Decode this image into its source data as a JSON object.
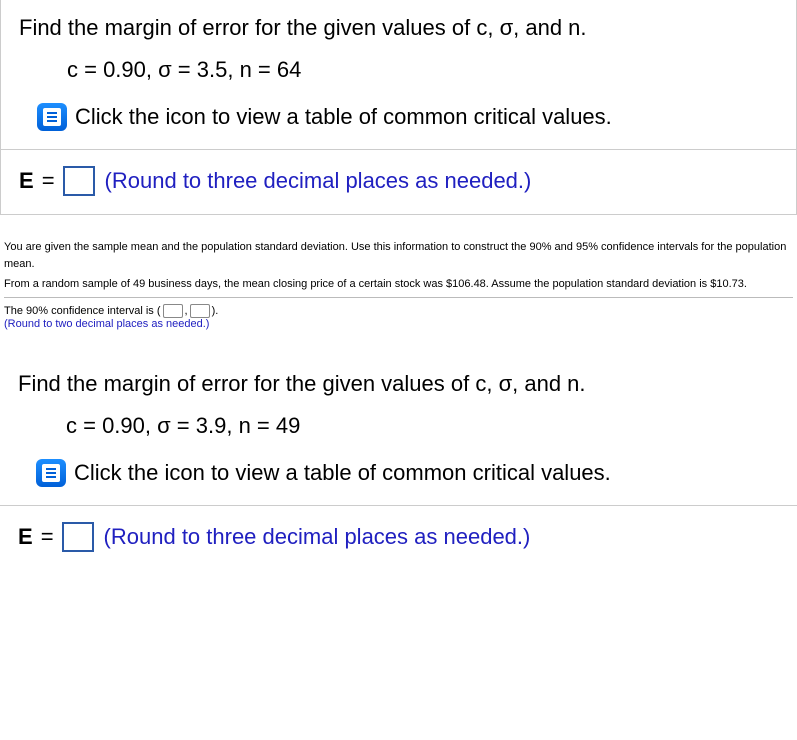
{
  "q1": {
    "prompt": "Find the margin of error for the given values of c, σ, and n.",
    "params": "c = 0.90, σ = 3.5, n = 64",
    "click_text": "Click the icon to view a table of common critical values.",
    "answer_var": "E",
    "answer_eq": "=",
    "round_note": "(Round to three decimal places as needed.)"
  },
  "mid": {
    "line1": "You are given the sample mean and the population standard deviation. Use this information to construct the 90% and 95% confidence intervals for the population mean.",
    "line2": "From a random sample of 49 business days, the mean closing price of a certain stock was $106.48. Assume the population standard deviation is $10.73.",
    "ci_prefix": "The 90% confidence interval is (",
    "ci_comma": ",",
    "ci_suffix": ").",
    "round_note": "(Round to two decimal places as needed.)"
  },
  "q2": {
    "prompt": "Find the margin of error for the given values of c, σ, and n.",
    "params": "c = 0.90, σ = 3.9, n = 49",
    "click_text": "Click the icon to view a table of common critical values.",
    "answer_var": "E",
    "answer_eq": "=",
    "round_note": "(Round to three decimal places as needed.)"
  }
}
